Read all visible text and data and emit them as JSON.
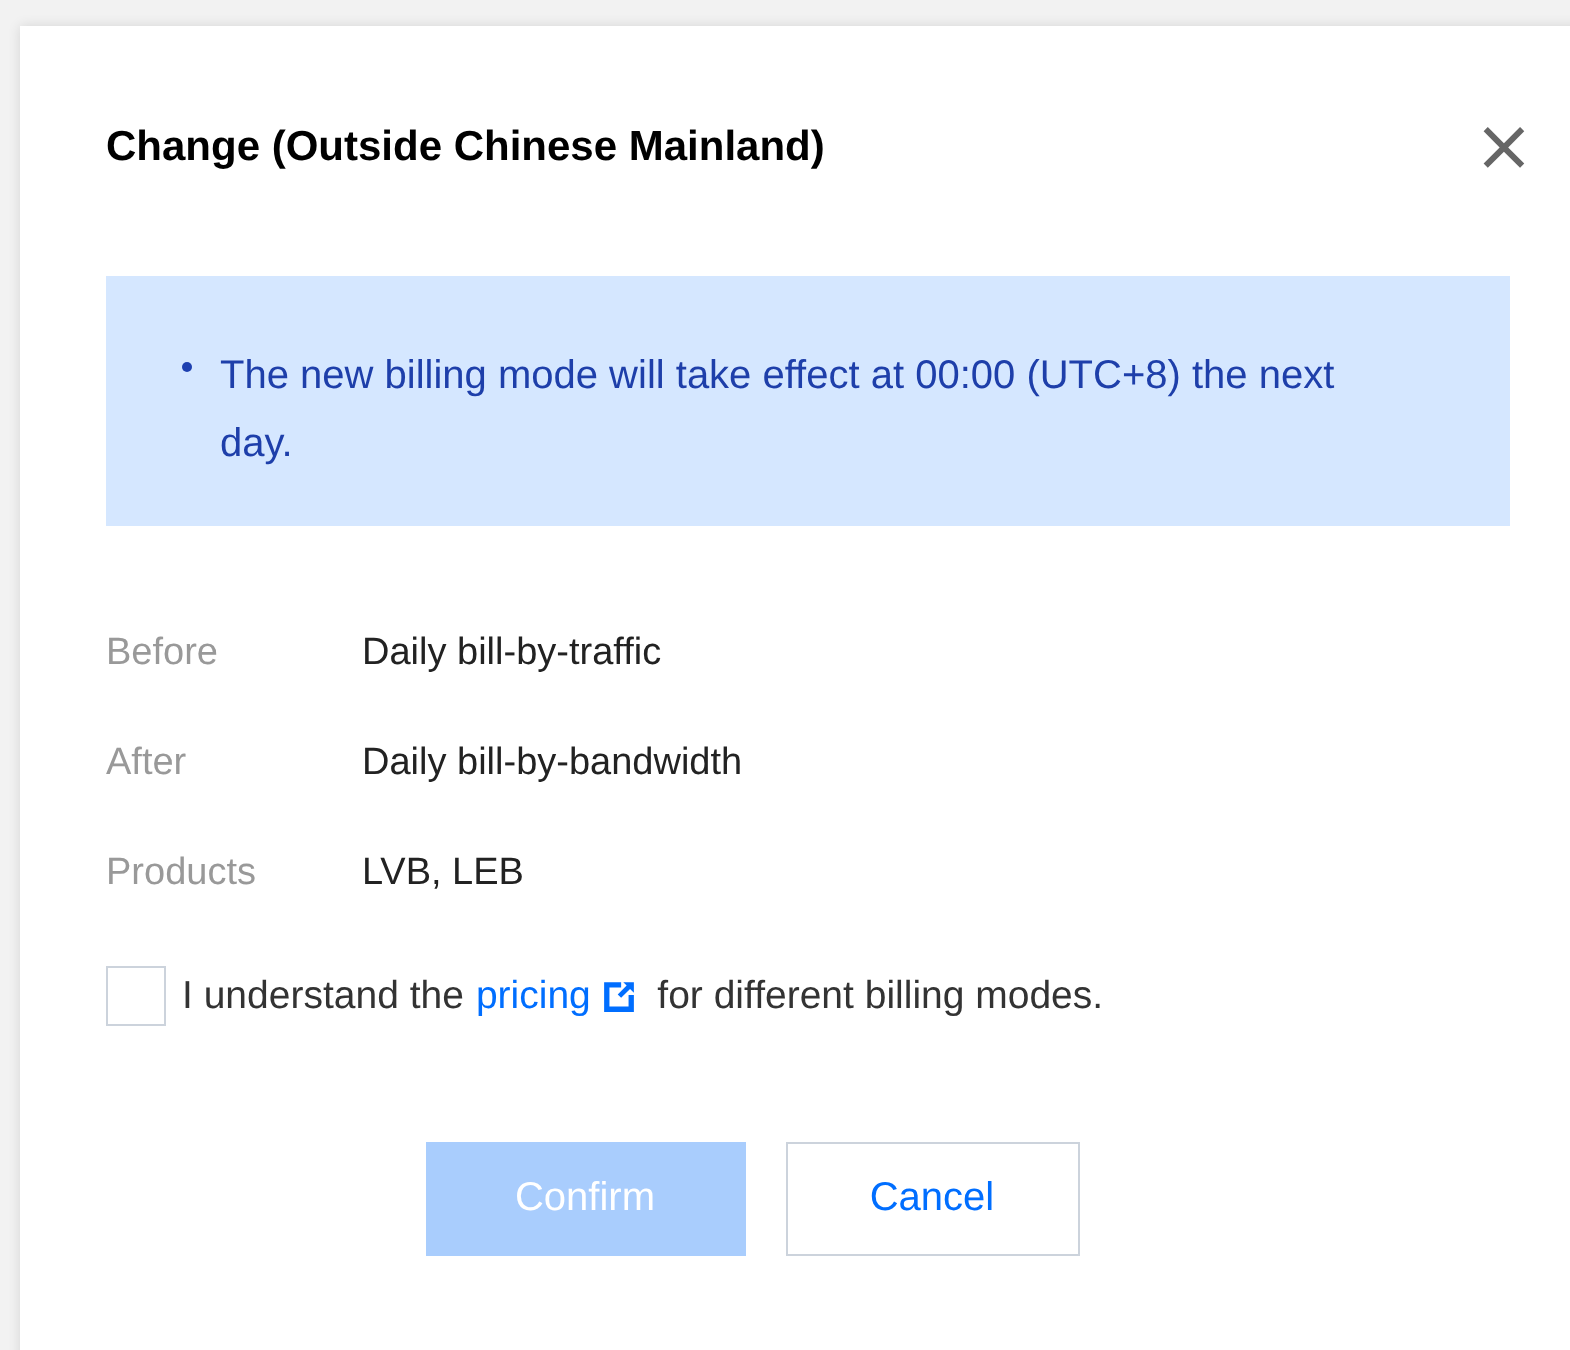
{
  "dialog": {
    "title": "Change (Outside Chinese Mainland)",
    "close": "×"
  },
  "notice": {
    "items": [
      "The new billing mode will take effect at 00:00 (UTC+8) the next day."
    ]
  },
  "details": [
    {
      "label": "Before",
      "value": "Daily bill-by-traffic"
    },
    {
      "label": "After",
      "value": "Daily bill-by-bandwidth"
    },
    {
      "label": "Products",
      "value": "LVB, LEB"
    }
  ],
  "agreement": {
    "checked": false,
    "before": "I understand the",
    "link": "pricing",
    "after": "for different billing modes."
  },
  "buttons": [
    {
      "label": "Confirm",
      "kind": "primary",
      "disabled": true
    },
    {
      "label": "Cancel",
      "kind": "secondary",
      "disabled": false
    }
  ]
}
